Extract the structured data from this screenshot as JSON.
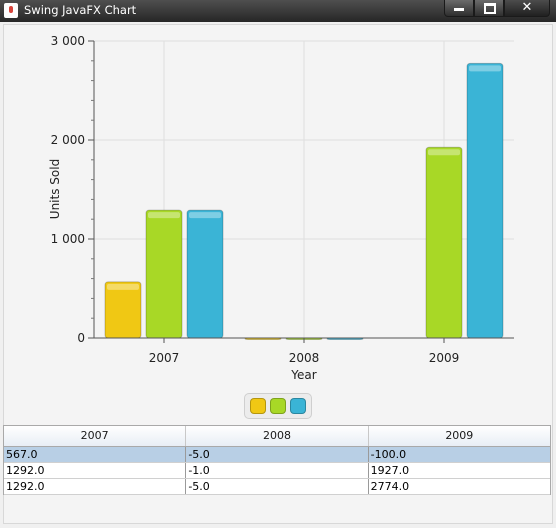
{
  "window": {
    "title": "Swing JavaFX Chart",
    "buttons": {
      "minimize": "minimize-icon",
      "maximize": "maximize-icon",
      "close": "close-icon"
    }
  },
  "chart_data": {
    "type": "bar",
    "categories": [
      "2007",
      "2008",
      "2009"
    ],
    "series": [
      {
        "values": [
          567,
          -5,
          -100
        ],
        "color": "#f0c814"
      },
      {
        "values": [
          1292,
          -1,
          1927
        ],
        "color": "#a8d826"
      },
      {
        "values": [
          1292,
          -5,
          2774
        ],
        "color": "#3ab4d6"
      }
    ],
    "xlabel": "Year",
    "ylabel": "Units Sold",
    "ylim": [
      0,
      3000
    ],
    "yticks": [
      0,
      1000,
      2000,
      3000
    ],
    "ytick_labels": [
      "0",
      "1 000",
      "2 000",
      "3 000"
    ],
    "grid": true,
    "legend": "bottom-center"
  },
  "legend": {
    "items": [
      {
        "color": "#f0c814"
      },
      {
        "color": "#a8d826"
      },
      {
        "color": "#3ab4d6"
      }
    ]
  },
  "table": {
    "columns": [
      "2007",
      "2008",
      "2009"
    ],
    "rows": [
      [
        "567.0",
        "-5.0",
        "-100.0"
      ],
      [
        "1292.0",
        "-1.0",
        "1927.0"
      ],
      [
        "1292.0",
        "-5.0",
        "2774.0"
      ]
    ],
    "selected_row": 0
  }
}
